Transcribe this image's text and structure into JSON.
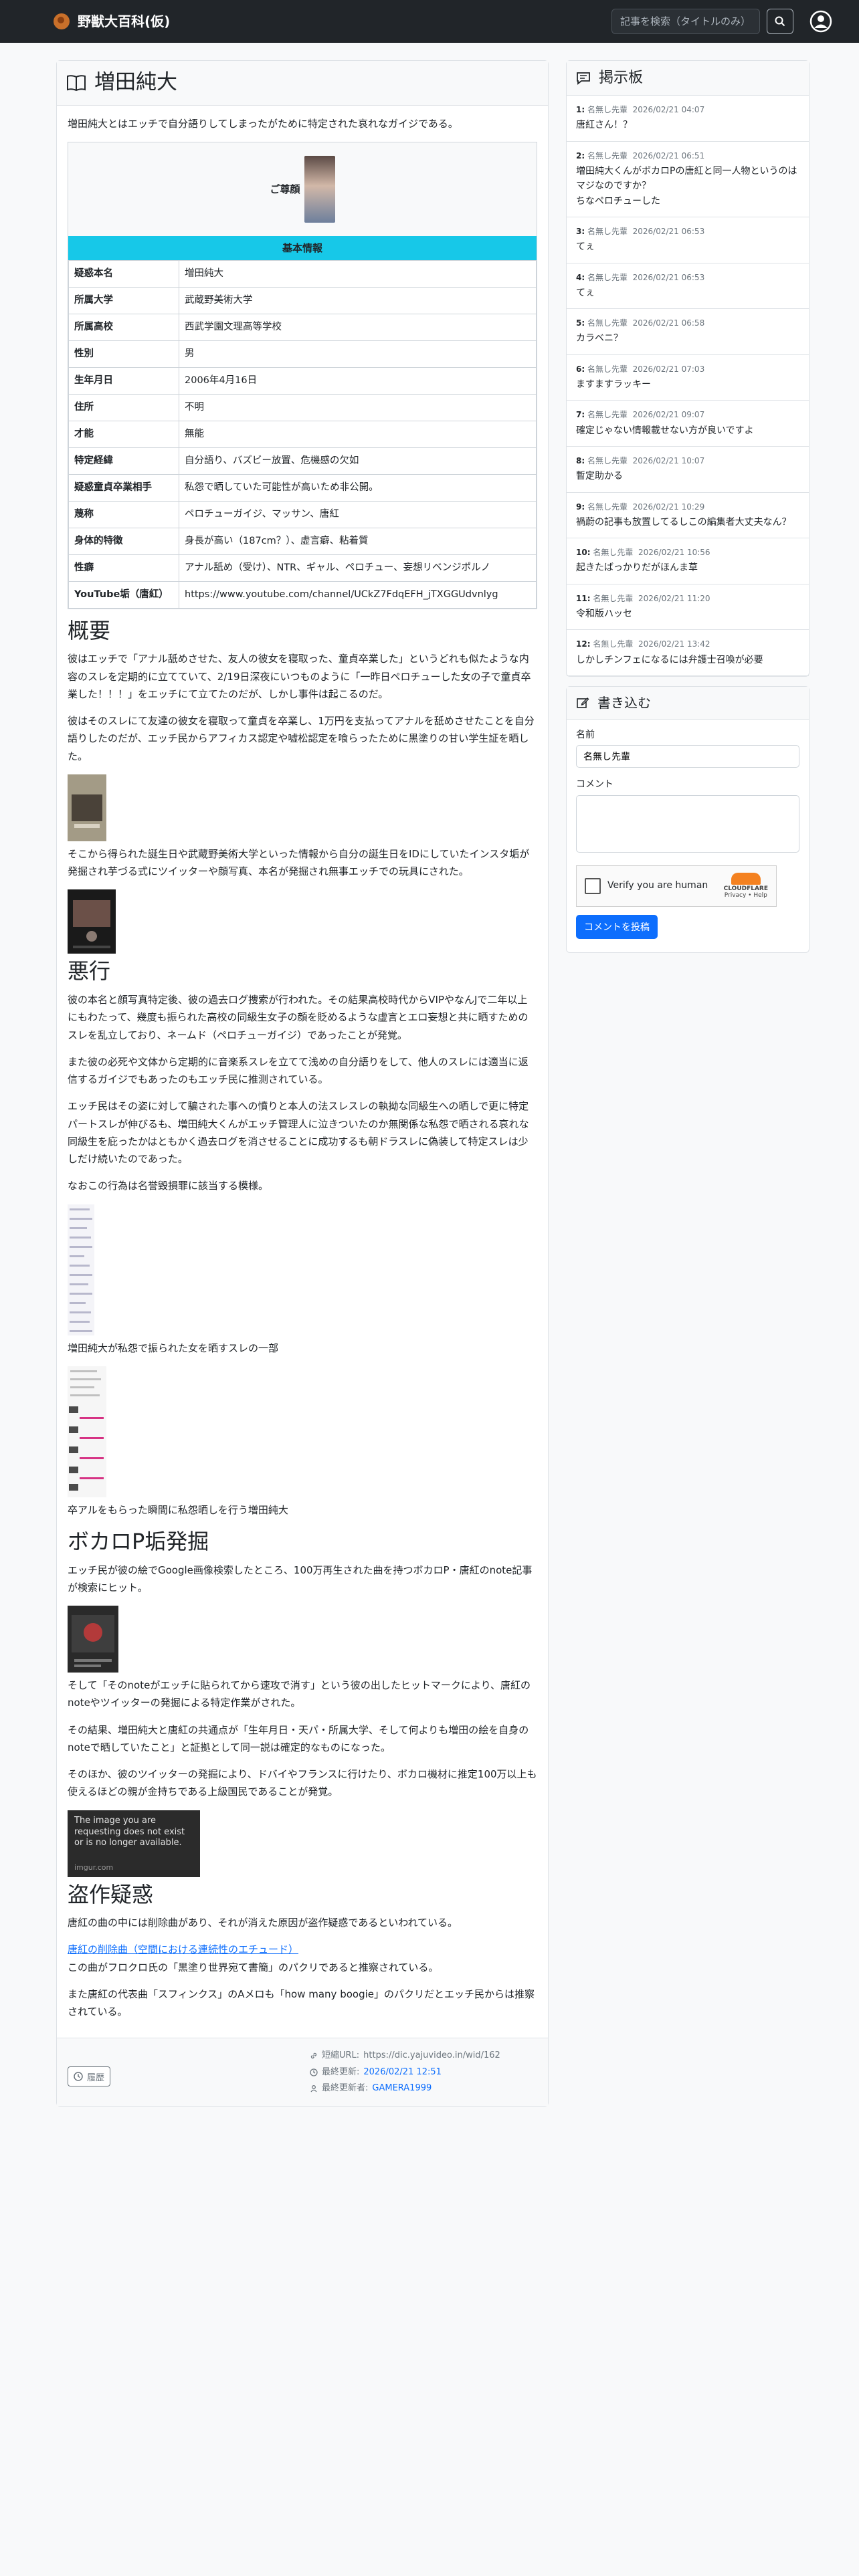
{
  "nav": {
    "brand": "野獣大百科(仮)",
    "search_placeholder": "記事を検索（タイトルのみ）"
  },
  "article": {
    "title": "増田純大",
    "lead": "増田純大とはエッチで自分語りしてしまったがために特定された哀れなガイジである。",
    "photo_caption": "ご尊顔",
    "info_header": "基本情報",
    "info": [
      {
        "k": "疑惑本名",
        "v": "増田純大"
      },
      {
        "k": "所属大学",
        "v": "武蔵野美術大学"
      },
      {
        "k": "所属高校",
        "v": "西武学園文理高等学校"
      },
      {
        "k": "性別",
        "v": "男"
      },
      {
        "k": "生年月日",
        "v": "2006年4月16日"
      },
      {
        "k": "住所",
        "v": "不明"
      },
      {
        "k": "才能",
        "v": "無能"
      },
      {
        "k": "特定経緯",
        "v": "自分語り、バズビー放置、危機感の欠如"
      },
      {
        "k": "疑惑童貞卒業相手",
        "v": "私怨で晒していた可能性が高いため非公開。"
      },
      {
        "k": "蔑称",
        "v": "ペロチューガイジ、マッサン、唐紅"
      },
      {
        "k": "身体的特徴",
        "v": "身長が高い（187cm？）、虚言癖、粘着質"
      },
      {
        "k": "性癖",
        "v": "アナル舐め（受け）、NTR、ギャル、ペロチュー、妄想リベンジポルノ"
      },
      {
        "k": "YouTube垢（唐紅）",
        "v": "https://www.youtube.com/channel/UCkZ7FdqEFH_jTXGGUdvnlyg"
      }
    ],
    "sections": {
      "overview_title": "概要",
      "overview_p1": "彼はエッチで「アナル舐めさせた、友人の彼女を寝取った、童貞卒業した」というどれも似たような内容のスレを定期的に立てていて、2/19日深夜にいつものように「一昨日ペロチューした女の子で童貞卒業した！！！」をエッチにて立てたのだが、しかし事件は起こるのだ。",
      "overview_p2": "彼はそのスレにて友達の彼女を寝取って童貞を卒業し、1万円を支払ってアナルを舐めさせたことを自分語りしたのだが、エッチ民からアフィカス認定や嘘松認定を喰らったために黒塗りの甘い学生証を晒した。",
      "overview_p3": "そこから得られた誕生日や武蔵野美術大学といった情報から自分の誕生日をIDにしていたインスタ垢が発掘され芋づる式にツイッターや顔写真、本名が発掘され無事エッチでの玩具にされた。",
      "misdeeds_title": "悪行",
      "misdeeds_p1": "彼の本名と顔写真特定後、彼の過去ログ捜索が行われた。その結果高校時代からVIPやなんJで二年以上にもわたって、幾度も振られた高校の同級生女子の顔を貶めるような虚言とエロ妄想と共に晒すためのスレを乱立しており、ネームド（ペロチューガイジ）であったことが発覚。",
      "misdeeds_p2": "また彼の必死や文体から定期的に音楽系スレを立てて浅めの自分語りをして、他人のスレには適当に返信するガイジでもあったのもエッチ民に推測されている。",
      "misdeeds_p3": "エッチ民はその姿に対して騙された事への憤りと本人の法スレスレの執拗な同級生への晒しで更に特定パートスレが伸びるも、増田純大くんがエッチ管理人に泣きついたのか無関係な私怨で晒される哀れな同級生を庇ったかはともかく過去ログを消させることに成功するも朝ドラスレに偽装して特定スレは少しだけ続いたのであった。",
      "misdeeds_p4": "なおこの行為は名誉毀損罪に該当する模様。",
      "caption1": "増田純大が私怨で振られた女を晒すスレの一部",
      "caption2": "卒アルをもらった瞬間に私怨晒しを行う増田純大",
      "vocaloid_title": "ボカロP垢発掘",
      "vocaloid_p1": "エッチ民が彼の絵でGoogle画像検索したところ、100万再生された曲を持つボカロP・唐紅のnote記事が検索にヒット。",
      "vocaloid_p2": "そして「そのnoteがエッチに貼られてから速攻で消す」という彼の出したヒットマークにより、唐紅のnoteやツイッターの発掘による特定作業がされた。",
      "vocaloid_p3": "その結果、増田純大と唐紅の共通点が「生年月日・天パ・所属大学、そして何よりも増田の絵を自身のnoteで晒していたこと」と証拠として同一説は確定的なものになった。",
      "vocaloid_p4": "そのほか、彼のツイッターの発掘により、ドバイやフランスに行けたり、ボカロ機材に推定100万以上も使えるほどの親が金持ちである上級国民であることが発覚。",
      "imgur_text": "The image you are requesting does not exist or is no longer available.",
      "imgur_domain": "imgur.com",
      "plagiarism_title": "盗作疑惑",
      "plagiarism_p1": "唐紅の曲の中には削除曲があり、それが消えた原因が盗作疑惑であるといわれている。",
      "plagiarism_link": "唐紅の削除曲（空間における連続性のエチュード）",
      "plagiarism_p2": "この曲がフロクロ氏の「黒塗り世界宛て書簡」のパクリであると推察されている。",
      "plagiarism_p3": "また唐紅の代表曲「スフィンクス」のAメロも「how many boogie」のパクリだとエッチ民からは推察されている。"
    },
    "footer": {
      "history_label": "履歴",
      "short_url_label": "短縮URL:",
      "short_url": "https://dic.yajuvideo.in/wid/162",
      "updated_label": "最終更新:",
      "updated": "2026/02/21 12:51",
      "updater_label": "最終更新者:",
      "updater": "GAMERA1999"
    }
  },
  "board": {
    "title": "掲示板",
    "posts": [
      {
        "no": "1:",
        "name": "名無し先輩",
        "date": "2026/02/21 04:07",
        "body": "唐紅さん！？"
      },
      {
        "no": "2:",
        "name": "名無し先輩",
        "date": "2026/02/21 06:51",
        "body": "増田純大くんがボカロPの唐紅と同一人物というのはマジなのですか？\nちなペロチューした"
      },
      {
        "no": "3:",
        "name": "名無し先輩",
        "date": "2026/02/21 06:53",
        "body": "てぇ"
      },
      {
        "no": "4:",
        "name": "名無し先輩",
        "date": "2026/02/21 06:53",
        "body": "てぇ"
      },
      {
        "no": "5:",
        "name": "名無し先輩",
        "date": "2026/02/21 06:58",
        "body": "カラベニ？"
      },
      {
        "no": "6:",
        "name": "名無し先輩",
        "date": "2026/02/21 07:03",
        "body": "ますますラッキー"
      },
      {
        "no": "7:",
        "name": "名無し先輩",
        "date": "2026/02/21 09:07",
        "body": "確定じゃない情報載せない方が良いですよ"
      },
      {
        "no": "8:",
        "name": "名無し先輩",
        "date": "2026/02/21 10:07",
        "body": "暫定助かる"
      },
      {
        "no": "9:",
        "name": "名無し先輩",
        "date": "2026/02/21 10:29",
        "body": "禍蔚の記事も放置してるしこの編集者大丈夫なん？"
      },
      {
        "no": "10:",
        "name": "名無し先輩",
        "date": "2026/02/21 10:56",
        "body": "起きたばっかりだがほんま草"
      },
      {
        "no": "11:",
        "name": "名無し先輩",
        "date": "2026/02/21 11:20",
        "body": "令和版ハッセ"
      },
      {
        "no": "12:",
        "name": "名無し先輩",
        "date": "2026/02/21 13:42",
        "body": "しかしチンフェになるには弁護士召喚が必要"
      }
    ]
  },
  "comment_form": {
    "title": "書き込む",
    "name_label": "名前",
    "name_value": "名無し先輩",
    "comment_label": "コメント",
    "captcha_label": "Verify you are human",
    "captcha_brand": "CLOUDFLARE",
    "captcha_links": "Privacy • Help",
    "submit_label": "コメントを投稿"
  }
}
